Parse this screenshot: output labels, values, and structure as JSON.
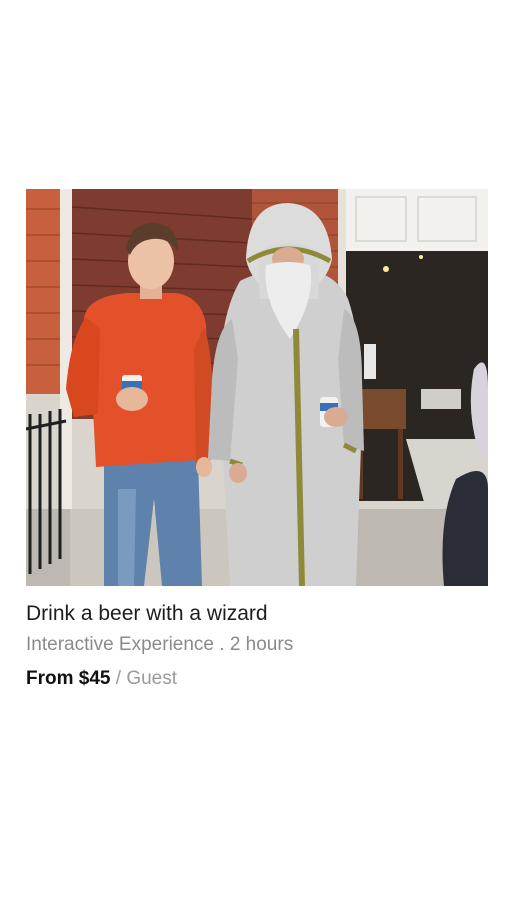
{
  "listing": {
    "image_alt": "Man in orange sweater holding a beer next to a person in a wizard costume",
    "title": "Drink a beer with a wizard",
    "subtitle": "Interactive Experience . 2 hours",
    "price_label": "From $45",
    "price_separator": "/",
    "price_unit": "Guest"
  }
}
